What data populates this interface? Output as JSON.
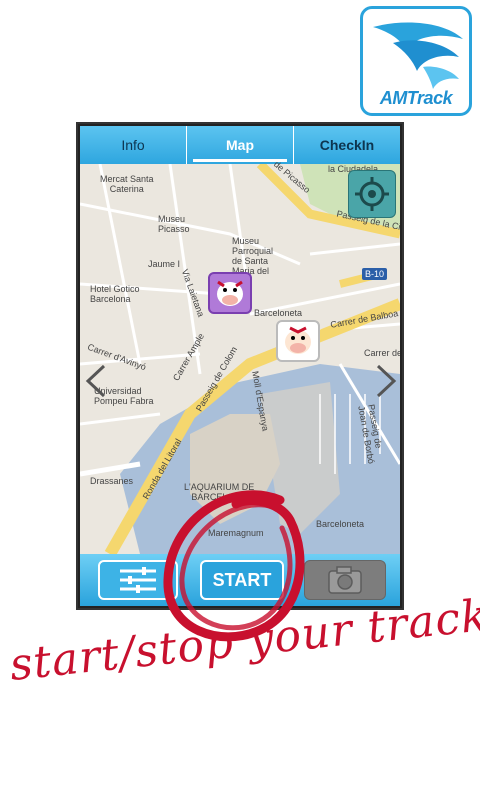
{
  "logo": {
    "text": "AMTrack"
  },
  "tabs": [
    {
      "label": "Info",
      "active": false
    },
    {
      "label": "Map",
      "active": true
    },
    {
      "label": "CheckIn",
      "active": false
    }
  ],
  "map": {
    "labels": {
      "mercat": "Mercat Santa\nCaterina",
      "museu_picasso": "Museu\nPicasso",
      "jaume": "Jaume I",
      "picasso": "de Picasso",
      "ciudadela": "la Ciudadela",
      "passeig_colom": "Passeig de Colom",
      "museu_parroquial": "Museu\nParroquial\nde Santa\nMaria del\nMar",
      "passeig_circ": "Passeig de la Circ",
      "b10": "B-10",
      "hotel_gotico": "Hotel Gotico\nBarcelona",
      "barceloneta": "Barceloneta",
      "carrer_balboa": "Carrer de Balboa",
      "carrer_avinyo": "Carrer d'Avinyó",
      "carrer_ample": "Carrer Ample",
      "universidad": "Universidad\nPompeu Fabra",
      "ronda_litoral": "Ronda del Litoral",
      "moll_espanya": "Moll d'Espanya",
      "passeig_joan_borbo": "Passeig de\nJoan de Borbó",
      "drassanes": "Drassanes",
      "aquarium": "L'AQUARIUM DE\nBARCELONA",
      "maremagnum": "Maremagnum",
      "barceloneta2": "Barceloneta",
      "via_laietana": "Via Laietana",
      "carrer_de": "Carrer de"
    }
  },
  "bottom_bar": {
    "start_label": "START"
  },
  "caption": "start/stop your track",
  "colors": {
    "accent": "#2aa3dc",
    "road_yellow": "#f5d76e",
    "water": "#a9bfd9",
    "caption_red": "#c8102e"
  }
}
